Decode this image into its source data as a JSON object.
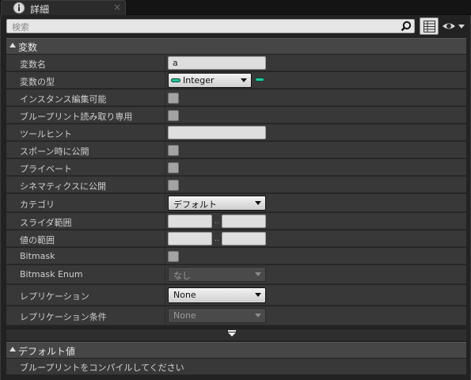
{
  "tab": {
    "title": "詳細",
    "close": "×",
    "icon": "info-icon"
  },
  "search": {
    "placeholder": "検索",
    "icon": "search-icon"
  },
  "toolbar": {
    "grid_icon": "grid-view-icon",
    "eye_icon": "eye-visibility-icon"
  },
  "variable_section": {
    "title": "変数",
    "rows": {
      "name": {
        "label": "変数名",
        "value": "a"
      },
      "type": {
        "label": "変数の型",
        "value": "Integer",
        "pin_color": "#26c49a"
      },
      "instance_editable": {
        "label": "インスタンス編集可能",
        "checked": false
      },
      "blueprint_readonly": {
        "label": "ブループリント読み取り専用",
        "checked": false
      },
      "tooltip": {
        "label": "ツールヒント",
        "value": ""
      },
      "expose_on_spawn": {
        "label": "スポーン時に公開",
        "checked": false
      },
      "private": {
        "label": "プライベート",
        "checked": false
      },
      "expose_cinematics": {
        "label": "シネマティクスに公開",
        "checked": false
      },
      "category": {
        "label": "カテゴリ",
        "value": "デフォルト"
      },
      "slider_range": {
        "label": "スライダ範囲",
        "sep": ".."
      },
      "value_range": {
        "label": "値の範囲",
        "sep": ".."
      },
      "bitmask": {
        "label": "Bitmask",
        "checked": false
      },
      "bitmask_enum": {
        "label": "Bitmask Enum",
        "value": "なし"
      },
      "replication": {
        "label": "レプリケーション",
        "value": "None"
      },
      "replication_condition": {
        "label": "レプリケーション条件",
        "value": "None"
      }
    }
  },
  "default_section": {
    "title": "デフォルト値",
    "message": "ブループリントをコンパイルしてください"
  },
  "colors": {
    "panel_bg": "#222222",
    "row_bg": "#383838",
    "header_bg": "#464646",
    "pin_green": "#26c49a"
  }
}
